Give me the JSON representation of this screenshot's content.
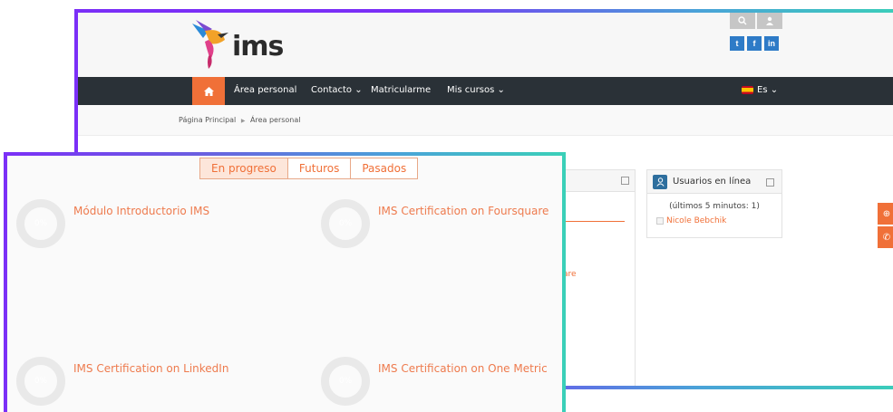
{
  "brand": {
    "name": "ims",
    "colors": {
      "accent": "#f07038",
      "nav": "#2a3137",
      "social": "#2e7bc7",
      "frame_start": "#7b2ff7",
      "frame_end": "#3ad0b8"
    }
  },
  "header": {
    "top_icons": [
      "search-icon",
      "user-icon"
    ],
    "social": [
      {
        "name": "twitter",
        "glyph": "t"
      },
      {
        "name": "facebook",
        "glyph": "f"
      },
      {
        "name": "linkedin",
        "glyph": "in"
      }
    ]
  },
  "nav": {
    "home_icon": "home-icon",
    "items": [
      "Área personal",
      "Contacto ⌄",
      "Matricularme",
      "Mis cursos ⌄"
    ],
    "language": "Es ⌄"
  },
  "breadcrumb": {
    "home": "Página Principal",
    "separator": "▶",
    "current": "Área personal"
  },
  "left_block": {
    "partial_text": "are"
  },
  "online_users": {
    "title": "Usuarios en línea",
    "subtitle": "(últimos 5 minutos: 1)",
    "users": [
      "Nicole Bebchik"
    ]
  },
  "course_overview": {
    "tabs": [
      {
        "label": "En progreso",
        "active": true
      },
      {
        "label": "Futuros",
        "active": false
      },
      {
        "label": "Pasados",
        "active": false
      }
    ],
    "courses": [
      {
        "title": "Módulo Introductorio IMS",
        "progress": "0%"
      },
      {
        "title": "IMS Certification on Foursquare",
        "progress": "0%"
      },
      {
        "title": "IMS Certification on LinkedIn",
        "progress": "0%"
      },
      {
        "title": "IMS Certification on One Metric",
        "progress": "0%"
      }
    ]
  }
}
